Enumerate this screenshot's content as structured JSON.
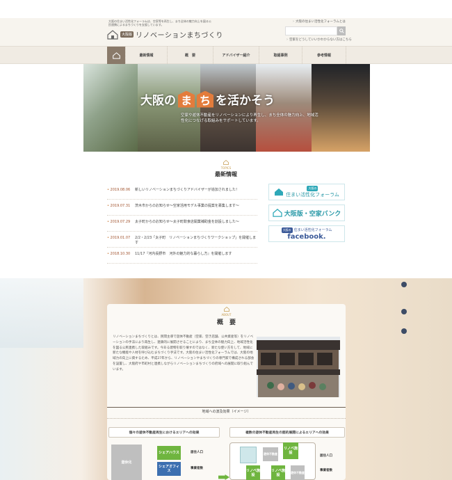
{
  "header": {
    "intro": "大阪の住まい活性化フォーラムは、空家等を再生し、まち全体の魅力向上を図る公民連携によるまちづくりを支援しています。",
    "badge": "大阪版",
    "site_name": "リノベーションまちづくり",
    "link_forum": "大阪の住まい活性化フォーラムとは",
    "link_consult": "空家をどうしていいかわからない方はこちら",
    "search_placeholder": ""
  },
  "nav": {
    "items": [
      "最新情報",
      "概　要",
      "アドバイザー紹介",
      "取組事例",
      "参考情報"
    ]
  },
  "hero": {
    "title_pre": "大阪の",
    "title_ma": "ま",
    "title_chi": "ち",
    "title_post": "を活かそう",
    "subtitle": "空家や遊休不動産をリノベーションにより再生し、まち全体の魅力向上、地域活性化につなげる取組みをサポートしています。"
  },
  "topics": {
    "label": "TOPICS",
    "heading": "最新情報",
    "items": [
      {
        "date": "2019.08.06",
        "text": "新しいリノベーションまちづくりアドバイザーが追加されました！"
      },
      {
        "date": "2019.07.31",
        "text": "茨木市からのお知らせ〜空家活用モデル事業の提案を募集します〜"
      },
      {
        "date": "2019.07.29",
        "text": "太子町からのお知らせ〜太子町飲食店開業補助金を創設しました〜"
      },
      {
        "date": "2019.01.07",
        "text": "2/2・2/23「太子町　リノベーションまちづくりワークショップ」を開催します"
      },
      {
        "date": "2018.10.30",
        "text": "11/17『河内長野市　河外の魅力的な暮らし方』を開催します"
      }
    ]
  },
  "banners": {
    "forum_small": "大阪の",
    "forum_big": "住まい活性化フォーラム",
    "bank": "大阪版・空家バンク",
    "fb_small": "大阪の",
    "fb_mid": "住まい活性化フォーラム",
    "fb_big": "facebook."
  },
  "about": {
    "label": "ABOUT",
    "heading": "概　要",
    "text": "リノベーションまちづくりとは、民間主導で遊休不動産（空家、空き店舗、公共資産等）をリノベーションの手法により再生し、連鎖的に展開させることにより、まち全体の魅力向上、地域活性化を図る公民連携した取組みです。今ある建物を取り壊すのではなく、新たな使い方をして、地域に新たな機能や人材を呼び込むまちづくり手法です。大阪の住まい活性化フォーラムでは、大阪の地域力の向上に資するため、平成27年から、リノベーションやまちづくりの専門家で構成される部会を設置し、大阪府や市町村と連携しながらリノベーションまちづくりの府域への展開に取り組んでいます。"
  },
  "effects": {
    "title": "地域への波及効果（イメージ）",
    "box_left": "個々の遊休不動産再生におけるエリアへの効果",
    "box_right": "複数の遊休不動産再生の面的展開によるエリアへの効果",
    "share_house": "シェアハウス",
    "share_office": "シェアオフィス",
    "vacant": "遊休化",
    "residents": "居住人口",
    "businesses": "事業者数",
    "renov": "リノベ施設",
    "vacant_house": "遊休不動産"
  },
  "colors": {
    "accent_orange": "#e37c3c",
    "teal": "#2b9aa8",
    "nav_bg": "#f0ebe3",
    "home_btn": "#8a7a6a"
  }
}
